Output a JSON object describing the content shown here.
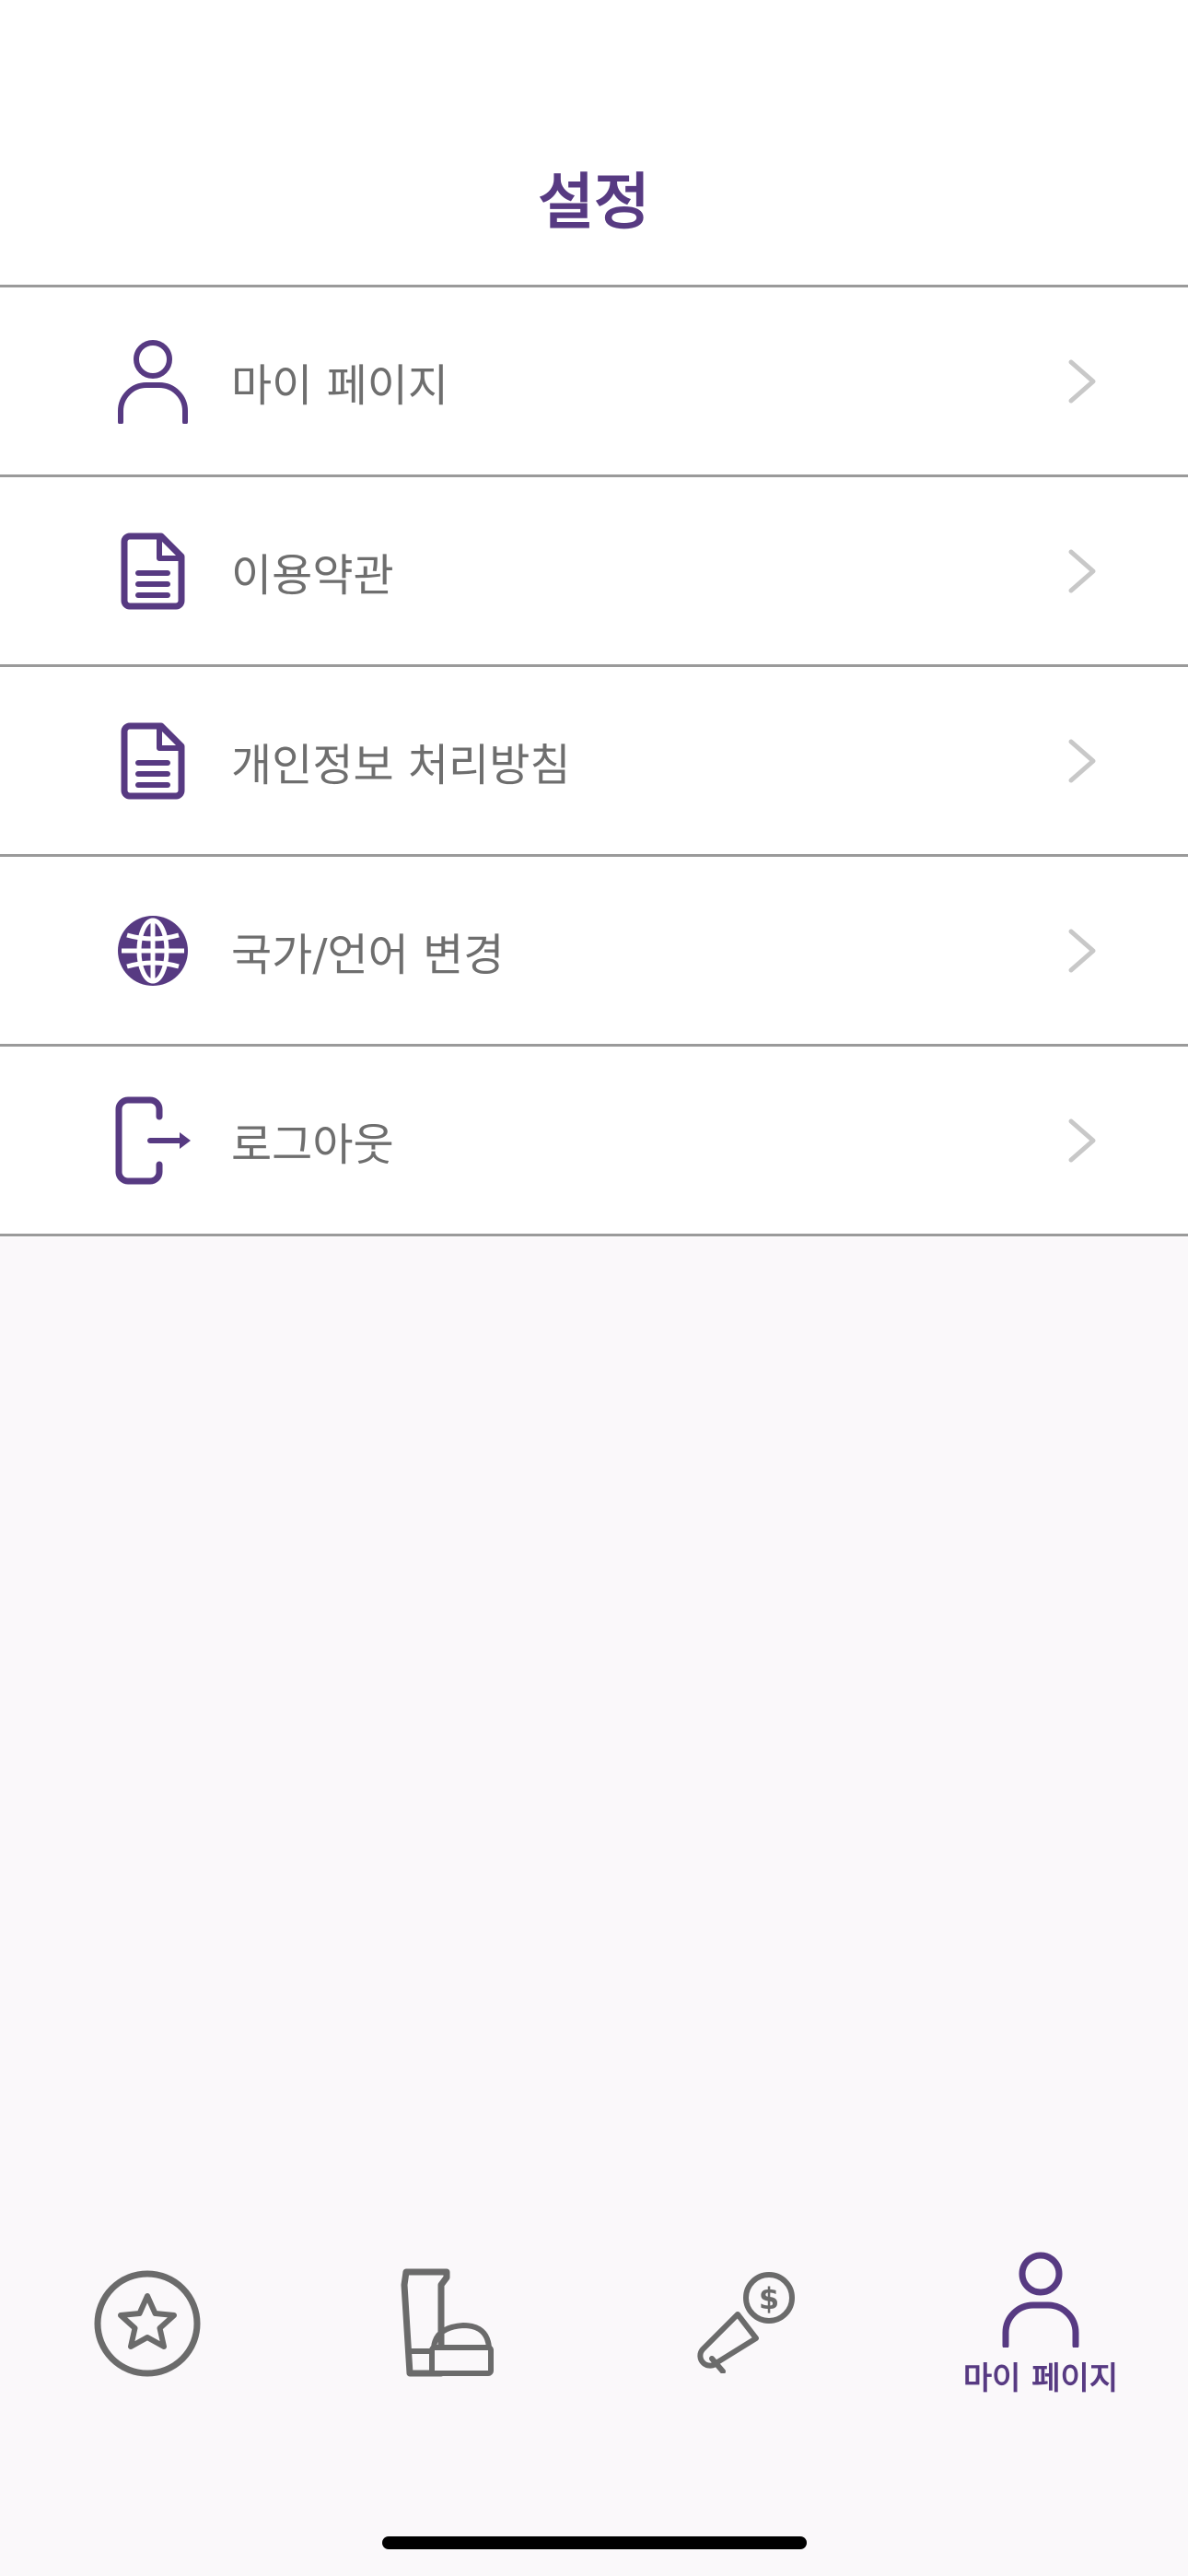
{
  "header": {
    "title": "설정"
  },
  "menu": {
    "items": [
      {
        "label": "마이 페이지",
        "icon": "user-icon"
      },
      {
        "label": "이용약관",
        "icon": "document-icon"
      },
      {
        "label": "개인정보 처리방침",
        "icon": "document-icon"
      },
      {
        "label": "국가/언어 변경",
        "icon": "globe-icon"
      },
      {
        "label": "로그아웃",
        "icon": "logout-icon"
      }
    ]
  },
  "tabbar": {
    "tabs": [
      {
        "icon": "star-circle-icon",
        "label": "",
        "active": false
      },
      {
        "icon": "cosmetics-icon",
        "label": "",
        "active": false
      },
      {
        "icon": "promotion-megaphone-icon",
        "label": "",
        "active": false
      },
      {
        "icon": "user-icon",
        "label": "마이 페이지",
        "active": true
      }
    ]
  },
  "colors": {
    "accent": "#573a82",
    "text": "#6e6e6e",
    "divider": "#9a9a9a",
    "inactive_icon": "#6b6b6b",
    "chevron": "#c8c8c8",
    "background": "#faf8fa"
  }
}
